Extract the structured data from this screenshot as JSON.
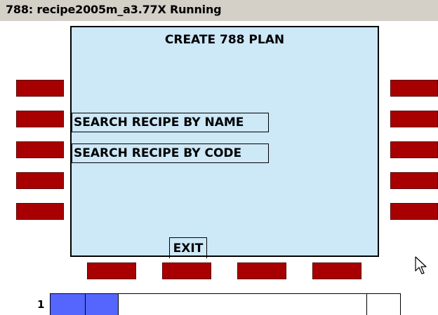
{
  "window": {
    "title": "788: recipe2005m_a3.77X Running"
  },
  "panel": {
    "title": "CREATE 788 PLAN",
    "buttons": {
      "search_by_name": "SEARCH RECIPE BY NAME",
      "search_by_code": "SEARCH RECIPE BY CODE",
      "exit": "EXIT"
    }
  },
  "softkeys": {
    "color": "#a80000",
    "left_count": 5,
    "right_count": 5,
    "bottom_count": 4
  },
  "status_bar": {
    "index": "1",
    "segment_color": "#5566ff",
    "filled_segments": 2
  },
  "colors": {
    "panel_background": "#cde8f7",
    "title_bar": "#d4d0c8"
  }
}
